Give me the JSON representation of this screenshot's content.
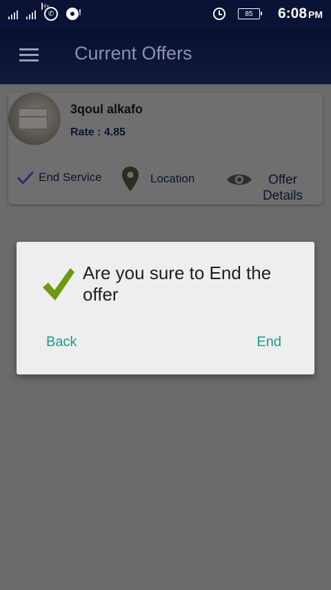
{
  "status_bar": {
    "network": "H+",
    "battery": "85",
    "time": "6:08",
    "ampm": "PM",
    "icons": [
      "signal-icon",
      "whatsapp-icon",
      "disk-icon",
      "alarm-icon",
      "battery-icon"
    ]
  },
  "app_bar": {
    "title": "Current Offers",
    "menu_icon": "hamburger-menu-icon"
  },
  "offer": {
    "name": "3qoul alkafo",
    "rate": "Rate : 4.85",
    "actions": {
      "end_service": "End Service",
      "location": "Location",
      "offer_details_line1": "Offer",
      "offer_details_line2": "Details"
    }
  },
  "dialog": {
    "message": "Are you sure to End the offer",
    "back_label": "Back",
    "end_label": "End"
  },
  "colors": {
    "accent": "#1b9a8a",
    "check": "#6a9a10",
    "appbar": "#0d1742"
  }
}
